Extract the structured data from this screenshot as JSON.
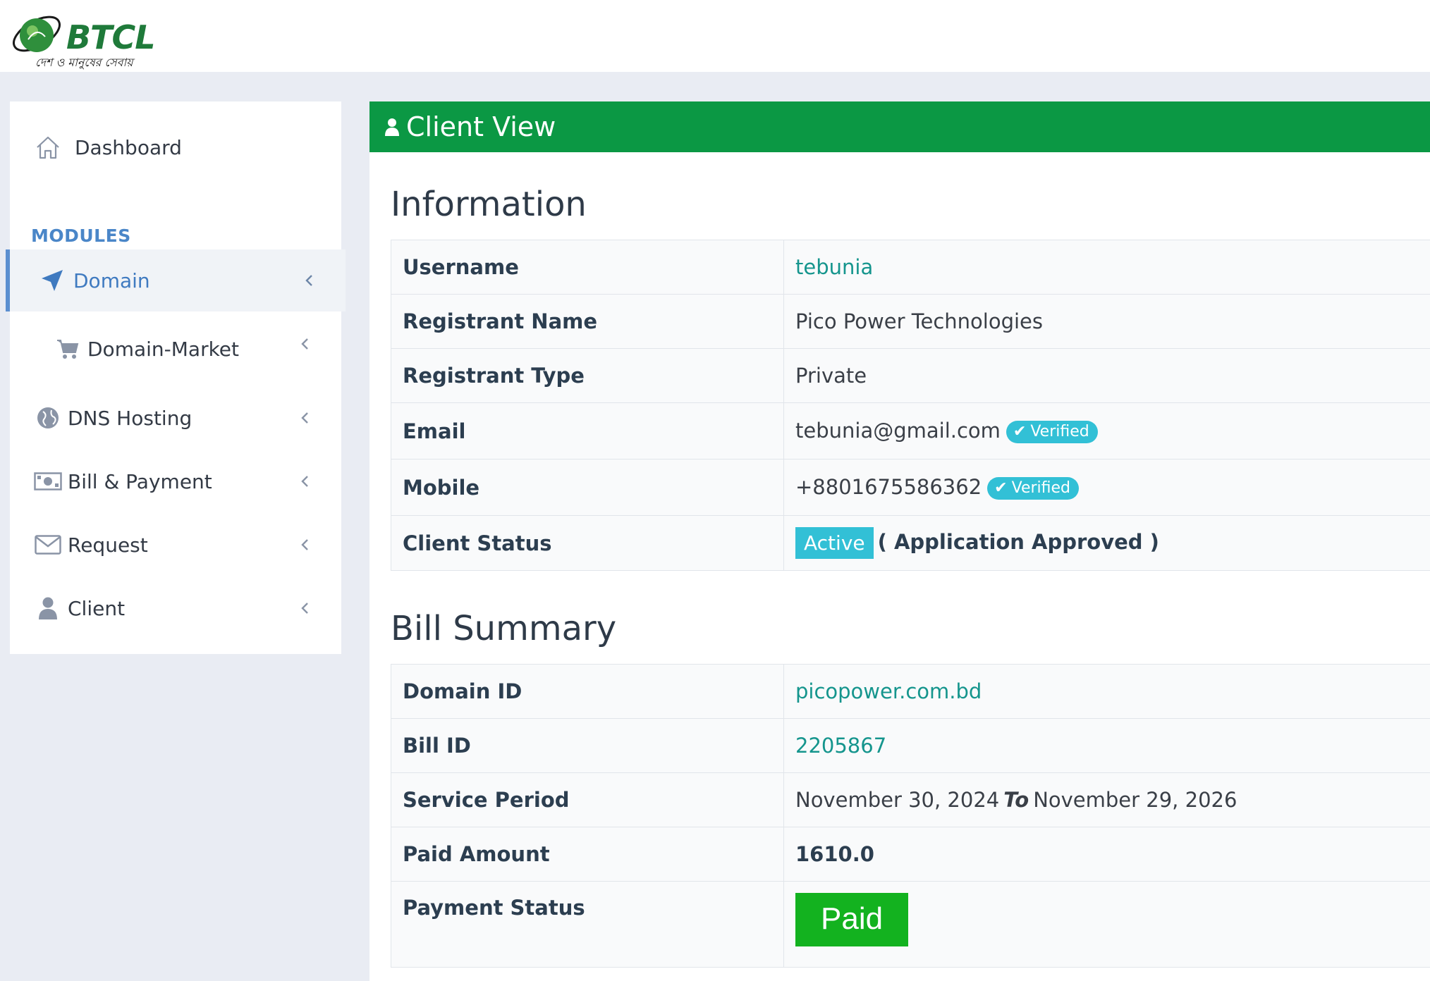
{
  "header": {
    "logo_text": "BTCL",
    "logo_tagline": "দেশ ও মানুষের সেবায়"
  },
  "sidebar": {
    "dashboard_label": "Dashboard",
    "modules_label": "MODULES",
    "items": [
      {
        "label": "Domain",
        "icon": "send-arrow-icon",
        "active": true
      },
      {
        "label": "Domain-Market",
        "icon": "cart-icon"
      },
      {
        "label": "DNS Hosting",
        "icon": "globe-icon"
      },
      {
        "label": "Bill & Payment",
        "icon": "money-icon"
      },
      {
        "label": "Request",
        "icon": "envelope-icon"
      },
      {
        "label": "Client",
        "icon": "user-icon"
      }
    ]
  },
  "panel": {
    "title": "Client View",
    "icon": "user-icon",
    "accent_color": "#0b9844"
  },
  "information": {
    "title": "Information",
    "rows": {
      "username": {
        "label": "Username",
        "value": "tebunia"
      },
      "registrant_name": {
        "label": "Registrant Name",
        "value": "Pico Power Technologies"
      },
      "registrant_type": {
        "label": "Registrant Type",
        "value": "Private"
      },
      "email": {
        "label": "Email",
        "value": "tebunia@gmail.com",
        "badge": "Verified"
      },
      "mobile": {
        "label": "Mobile",
        "value": "+8801675586362",
        "badge": "Verified"
      },
      "client_status": {
        "label": "Client Status",
        "status": "Active",
        "note": "( Application Approved )"
      }
    }
  },
  "bill_summary": {
    "title": "Bill Summary",
    "rows": {
      "domain_id": {
        "label": "Domain ID",
        "value": "picopower.com.bd"
      },
      "bill_id": {
        "label": "Bill ID",
        "value": "2205867"
      },
      "service_period": {
        "label": "Service Period",
        "from": "November 30, 2024",
        "to_word": "To",
        "to": "November 29, 2026"
      },
      "paid_amount": {
        "label": "Paid Amount",
        "value": "1610.0"
      },
      "payment_status": {
        "label": "Payment Status",
        "value": "Paid"
      }
    }
  }
}
